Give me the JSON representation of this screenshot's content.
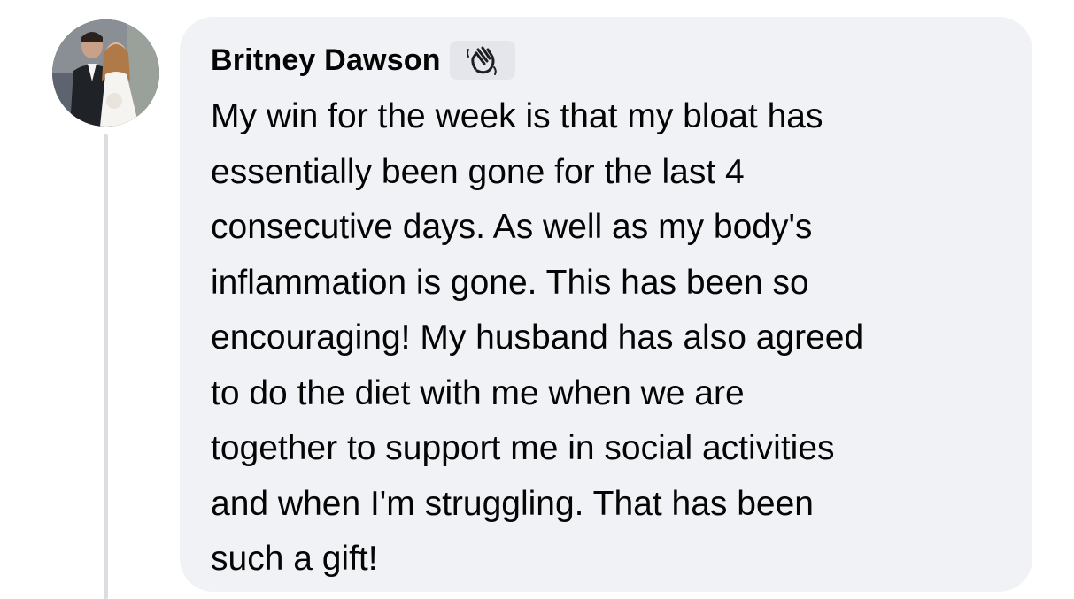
{
  "comment": {
    "author": "Britney Dawson",
    "author_badge_icon": "waving-hand-icon",
    "text": "My win for the week is that my bloat has\nessentially been gone for the last 4\nconsecutive days. As well as my body's\ninflammation is gone. This has been so\nencouraging! My husband has also agreed\nto do the diet with me when we are\ntogether to support me in social activities\nand when I'm struggling. That has been\nsuch a gift!"
  },
  "colors": {
    "bubble_background": "#f0f2f5",
    "text": "#050505",
    "thread_line": "#dcdde1"
  }
}
